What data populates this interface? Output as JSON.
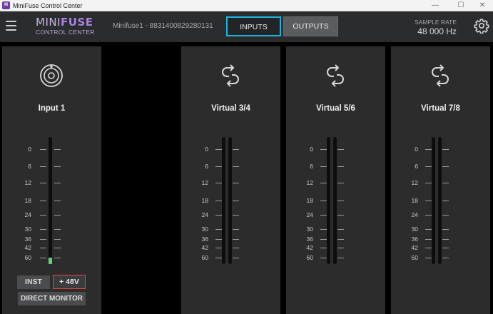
{
  "window": {
    "title": "MiniFuse Control Center",
    "minimize": "—",
    "maximize": "☐",
    "close": "✕"
  },
  "header": {
    "logo_mini": "MINI",
    "logo_fuse": "FUSE",
    "logo_subtitle": "CONTROL CENTER",
    "device_name": "Minifuse1 - 8831400829280131",
    "tabs": [
      "INPUTS",
      "OUTPUTS"
    ],
    "active_tab": "INPUTS",
    "sample_rate_label": "SAMPLE RATE",
    "sample_rate_value": "48 000 Hz"
  },
  "colors": {
    "accent": "#1fb3e3",
    "brand": "#a883e0",
    "phantom_red": "#e04646",
    "meter_green": "#5dd67a"
  },
  "scale": [
    "0",
    "6",
    "12",
    "18",
    "24",
    "30",
    "36",
    "42",
    "60"
  ],
  "channels": [
    {
      "name": "Input 1",
      "icon": "xlr-combo-jack-icon",
      "buttons": {
        "inst": "INST",
        "phantom": "+ 48V",
        "direct_monitor": "DIRECT MONITOR"
      },
      "level": 0.05
    },
    {
      "name": "Virtual 3/4",
      "icon": "loopback-icon"
    },
    {
      "name": "Virtual 5/6",
      "icon": "loopback-icon"
    },
    {
      "name": "Virtual 7/8",
      "icon": "loopback-icon"
    }
  ]
}
